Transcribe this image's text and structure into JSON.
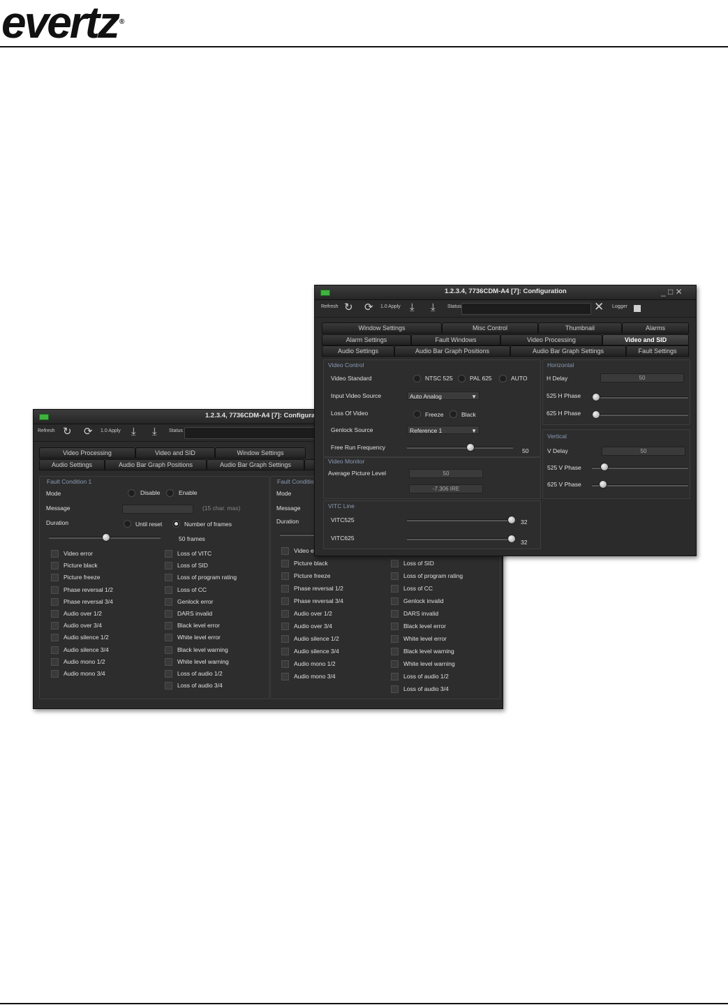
{
  "header": {
    "logo_text": "evertz",
    "logo_reg": "®"
  },
  "back_window": {
    "title": "1.2.3.4, 7736CDM-A4  [7]: Configura",
    "toolbar": {
      "refresh": "Refresh",
      "apply": "1.0 Apply",
      "status": "Status"
    },
    "tabs_row1": [
      "Video Processing",
      "Video and SID",
      "Window Settings"
    ],
    "tabs_row2": [
      "Audio Settings",
      "Audio Bar Graph Positions",
      "Audio Bar Graph Settings",
      "I"
    ],
    "fault1": {
      "title": "Fault Condition 1",
      "mode_label": "Mode",
      "disable": "Disable",
      "enable": "Enable",
      "message_label": "Message",
      "message_hint": "(15 char. max)",
      "duration_label": "Duration",
      "until_reset": "Until reset",
      "number_of_frames": "Number of frames",
      "frames_value": "50 frames",
      "col1": [
        "Video error",
        "Picture black",
        "Picture freeze",
        "Phase reversal 1/2",
        "Phase reversal 3/4",
        "Audio over 1/2",
        "Audio over 3/4",
        "Audio silence 1/2",
        "Audio silence 3/4",
        "Audio mono 1/2",
        "Audio mono 3/4"
      ],
      "col2": [
        "Loss of VITC",
        "Loss of SID",
        "Loss of program rating",
        "Loss of CC",
        "Genlock error",
        "DARS invalid",
        "Black level error",
        "White level error",
        "Black level warning",
        "White level warning",
        "Loss of audio 1/2",
        "Loss of audio 3/4"
      ]
    },
    "fault2": {
      "title": "Fault Conditio",
      "mode_label": "Mode",
      "message_label": "Message",
      "duration_label": "Duration",
      "col1": [
        "Video e",
        "Picture black",
        "Picture freeze",
        "Phase reversal 1/2",
        "Phase reversal 3/4",
        "Audio over 1/2",
        "Audio over 3/4",
        "Audio silence  1/2",
        "Audio silence  3/4",
        "Audio mono 1/2",
        "Audio mono 3/4"
      ],
      "col2": [
        "Loss of SID",
        "Loss of program rating",
        "Loss of CC",
        "Genlock invalid",
        "DARS invalid",
        "Black level error",
        "White level error",
        "Black level warning",
        "White level warning",
        "Loss of audio 1/2",
        "Loss of audio 3/4"
      ]
    }
  },
  "front_window": {
    "title": "1.2.3.4, 7736CDM-A4  [7]: Configuration",
    "window_buttons": "_ □ ✕",
    "toolbar": {
      "refresh": "Refresh",
      "apply": "1.0 Apply",
      "status": "Status",
      "logger": "Logger"
    },
    "tabs_row1": [
      "Window Settings",
      "Misc Control",
      "Thumbnail",
      "Alarms"
    ],
    "tabs_row2": [
      "Alarm Settings",
      "Fault Windows",
      "Video Processing",
      "Video and SID"
    ],
    "tabs_row3": [
      "Audio Settings",
      "Audio Bar Graph Positions",
      "Audio Bar Graph Settings",
      "Fault Settings"
    ],
    "video_control": {
      "title": "Video Control",
      "video_standard": "Video Standard",
      "ntsc": "NTSC 525",
      "pal": "PAL 625",
      "auto": "AUTO",
      "input_video_source": "Input Video Source",
      "input_value": "Auto Analog",
      "loss_of_video": "Loss Of Video",
      "freeze": "Freeze",
      "black": "Black",
      "genlock_source": "Genlock Source",
      "genlock_value": "Reference 1",
      "free_run_frequency": "Free Run Frequency",
      "free_run_value": "50"
    },
    "video_monitor": {
      "title": "Video Monitor",
      "apl_label": "Average Picture Level",
      "apl_value": "50",
      "ire_value": "-7.306 IRE"
    },
    "vitc_line": {
      "title": "VITC Line",
      "vitc525": "VITC525",
      "vitc525_value": "32",
      "vitc625": "VITC625",
      "vitc625_value": "32"
    },
    "horizontal": {
      "title": "Horizontal",
      "h_delay": "H Delay",
      "h_delay_value": "50",
      "h525": "525 H Phase",
      "h625": "625 H Phase"
    },
    "vertical": {
      "title": "Vertical",
      "v_delay": "V Delay",
      "v_delay_value": "50",
      "v525": "525 V Phase",
      "v625": "625 V Phase"
    }
  }
}
